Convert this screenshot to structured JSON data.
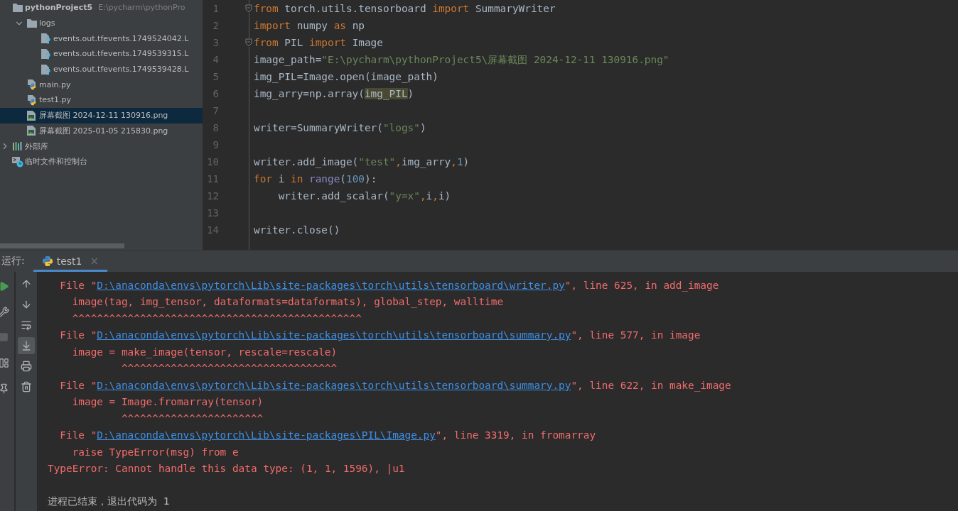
{
  "project_tree": {
    "items": [
      {
        "kind": "root",
        "label": "pythonProject5",
        "path": "E:\\pycharm\\pythonPro",
        "selected": false,
        "children": [
          {
            "kind": "folder",
            "label": "logs",
            "expanded": true,
            "selected": false,
            "children": [
              {
                "kind": "unknown",
                "label": "events.out.tfevents.1749524042.L",
                "selected": false
              },
              {
                "kind": "unknown",
                "label": "events.out.tfevents.1749539315.L",
                "selected": false
              },
              {
                "kind": "unknown",
                "label": "events.out.tfevents.1749539428.L",
                "selected": false
              }
            ]
          },
          {
            "kind": "python",
            "label": "main.py",
            "selected": false
          },
          {
            "kind": "python",
            "label": "test1.py",
            "selected": false
          },
          {
            "kind": "image",
            "label": "屏幕截图 2024-12-11 130916.png",
            "selected": true
          },
          {
            "kind": "image",
            "label": "屏幕截图 2025-01-05 215830.png",
            "selected": false
          }
        ]
      },
      {
        "kind": "library",
        "label": "外部库",
        "expanded": false,
        "selected": false
      },
      {
        "kind": "scratch",
        "label": "临时文件和控制台",
        "selected": false
      }
    ]
  },
  "editor": {
    "lines": [
      {
        "number": "1",
        "fold": true,
        "segments": [
          {
            "kind": "kw",
            "text": "from"
          },
          {
            "kind": "plain",
            "text": " torch.utils.tensorboard "
          },
          {
            "kind": "kw",
            "text": "import"
          },
          {
            "kind": "plain",
            "text": " SummaryWriter"
          }
        ]
      },
      {
        "number": "2",
        "fold": false,
        "segments": [
          {
            "kind": "kw",
            "text": "import"
          },
          {
            "kind": "plain",
            "text": " numpy "
          },
          {
            "kind": "kw",
            "text": "as"
          },
          {
            "kind": "plain",
            "text": " np"
          }
        ]
      },
      {
        "number": "3",
        "fold": true,
        "segments": [
          {
            "kind": "kw",
            "text": "from"
          },
          {
            "kind": "plain",
            "text": " PIL "
          },
          {
            "kind": "kw",
            "text": "import"
          },
          {
            "kind": "plain",
            "text": " Image"
          }
        ]
      },
      {
        "number": "4",
        "fold": false,
        "segments": [
          {
            "kind": "plain",
            "text": "image_path="
          },
          {
            "kind": "str",
            "text": "\"E:\\pycharm\\pythonProject5\\屏幕截图 2024-12-11 130916.png\""
          }
        ]
      },
      {
        "number": "5",
        "fold": false,
        "segments": [
          {
            "kind": "plain",
            "text": "img_PIL=Image.open(image_path)"
          }
        ]
      },
      {
        "number": "6",
        "fold": false,
        "segments": [
          {
            "kind": "plain",
            "text": "img_arry=np.array("
          },
          {
            "kind": "hl",
            "text": "img_PIL"
          },
          {
            "kind": "plain",
            "text": ")"
          }
        ]
      },
      {
        "number": "7",
        "fold": false
      },
      {
        "number": "8",
        "fold": false,
        "segments": [
          {
            "kind": "plain",
            "text": "writer=SummaryWriter("
          },
          {
            "kind": "str",
            "text": "\"logs\""
          },
          {
            "kind": "plain",
            "text": ")"
          }
        ]
      },
      {
        "number": "9",
        "fold": false
      },
      {
        "number": "10",
        "fold": false,
        "segments": [
          {
            "kind": "plain",
            "text": "writer.add_image("
          },
          {
            "kind": "str",
            "text": "\"test\""
          },
          {
            "kind": "kw",
            "text": ","
          },
          {
            "kind": "plain",
            "text": "img_arry"
          },
          {
            "kind": "kw",
            "text": ","
          },
          {
            "kind": "num",
            "text": "1"
          },
          {
            "kind": "plain",
            "text": ")"
          }
        ]
      },
      {
        "number": "11",
        "fold": false,
        "segments": [
          {
            "kind": "kw",
            "text": "for"
          },
          {
            "kind": "plain",
            "text": " i "
          },
          {
            "kind": "kw",
            "text": "in"
          },
          {
            "kind": "builtin",
            "text": " range"
          },
          {
            "kind": "plain",
            "text": "("
          },
          {
            "kind": "num",
            "text": "100"
          },
          {
            "kind": "plain",
            "text": "):"
          }
        ]
      },
      {
        "number": "12",
        "fold": false,
        "segments": [
          {
            "kind": "plain",
            "text": "    writer.add_scalar("
          },
          {
            "kind": "str",
            "text": "\"y=x\""
          },
          {
            "kind": "kw",
            "text": ","
          },
          {
            "kind": "plain",
            "text": "i"
          },
          {
            "kind": "kw",
            "text": ","
          },
          {
            "kind": "plain",
            "text": "i)"
          }
        ]
      },
      {
        "number": "13",
        "fold": false
      },
      {
        "number": "14",
        "fold": false,
        "segments": [
          {
            "kind": "plain",
            "text": "writer.close()"
          }
        ]
      }
    ]
  },
  "run_panel": {
    "label": "运行:",
    "tabs": [
      {
        "label": "test1",
        "selected": true,
        "close": "×"
      }
    ],
    "side_toolbar": [
      {
        "kind": "run",
        "disabled": false
      },
      {
        "kind": "settings",
        "disabled": false
      },
      {
        "kind": "stop",
        "disabled": true
      },
      {
        "kind": "layout",
        "disabled": false
      },
      {
        "kind": "pin",
        "disabled": false
      }
    ],
    "console_toolbar": [
      {
        "kind": "up",
        "selected": false
      },
      {
        "kind": "down",
        "selected": false
      },
      {
        "kind": "wrap",
        "selected": false
      },
      {
        "kind": "scroll-end",
        "selected": true
      },
      {
        "kind": "print",
        "selected": false
      },
      {
        "kind": "delete",
        "selected": false
      }
    ],
    "console_lines": [
      {
        "kind": "frame",
        "prefix": "File \"",
        "path": "D:\\anaconda\\envs\\pytorch\\Lib\\site-packages\\torch\\utils\\tensorboard\\writer.py",
        "suffix": "\", line 625, in add_image"
      },
      {
        "kind": "code",
        "text": "image(tag, img_tensor, dataformats=dataformats), global_step, walltime"
      },
      {
        "kind": "code",
        "text": "^^^^^^^^^^^^^^^^^^^^^^^^^^^^^^^^^^^^^^^^^^^^^^^"
      },
      {
        "kind": "frame",
        "prefix": "File \"",
        "path": "D:\\anaconda\\envs\\pytorch\\Lib\\site-packages\\torch\\utils\\tensorboard\\summary.py",
        "suffix": "\", line 577, in image"
      },
      {
        "kind": "code",
        "text": "image = make_image(tensor, rescale=rescale)"
      },
      {
        "kind": "caret",
        "text": "^^^^^^^^^^^^^^^^^^^^^^^^^^^^^^^^^^^"
      },
      {
        "kind": "frame",
        "prefix": "File \"",
        "path": "D:\\anaconda\\envs\\pytorch\\Lib\\site-packages\\torch\\utils\\tensorboard\\summary.py",
        "suffix": "\", line 622, in make_image"
      },
      {
        "kind": "code",
        "text": "image = Image.fromarray(tensor)"
      },
      {
        "kind": "caret",
        "text": "^^^^^^^^^^^^^^^^^^^^^^^"
      },
      {
        "kind": "frame",
        "prefix": "File \"",
        "path": "D:\\anaconda\\envs\\pytorch\\Lib\\site-packages\\PIL\\Image.py",
        "suffix": "\", line 3319, in fromarray"
      },
      {
        "kind": "code",
        "text": "raise TypeError(msg) from e"
      },
      {
        "kind": "message",
        "text": "TypeError: Cannot handle this data type: (1, 1, 1596), |u1"
      },
      {
        "kind": "exit",
        "text": "进程已结束，退出代码为 1"
      }
    ]
  }
}
